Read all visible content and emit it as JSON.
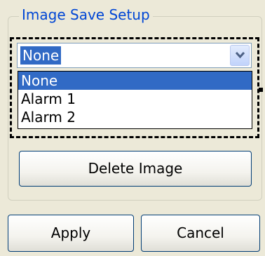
{
  "group": {
    "title": "Image Save Setup"
  },
  "combo": {
    "selected_value": "None",
    "options": [
      "None",
      "Alarm 1",
      "Alarm 2"
    ],
    "highlighted_option": "None",
    "button_icon": "chevron-down-icon"
  },
  "buttons": {
    "delete_image": "Delete Image",
    "apply": "Apply",
    "cancel": "Cancel"
  },
  "colors": {
    "background": "#ece9d8",
    "group_title": "#0046d5",
    "selection": "#316ac5",
    "button_border": "#003c74"
  }
}
